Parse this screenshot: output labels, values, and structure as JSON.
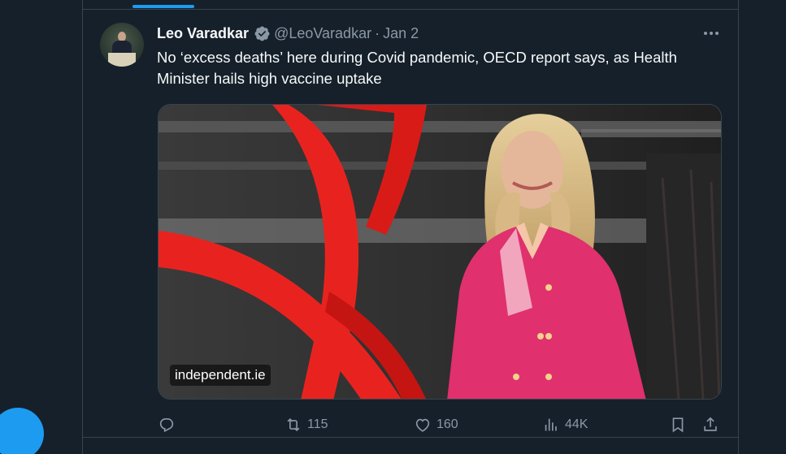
{
  "tweet": {
    "display_name": "Leo Varadkar",
    "handle": "@LeoVaradkar",
    "separator": "·",
    "date": "Jan 2",
    "text": "No ‘excess deaths’ here during Covid pandemic, OECD report says, as Health Minister hails high vaccine uptake",
    "verified": true,
    "more_icon": "more-horizontal-icon"
  },
  "card": {
    "source": "independent.ie"
  },
  "actions": {
    "reply": {
      "icon": "reply-icon",
      "count": ""
    },
    "retweet": {
      "icon": "retweet-icon",
      "count": "115"
    },
    "like": {
      "icon": "heart-icon",
      "count": "160"
    },
    "views": {
      "icon": "views-icon",
      "count": "44K"
    },
    "bookmark": {
      "icon": "bookmark-icon"
    },
    "share": {
      "icon": "share-icon"
    }
  },
  "colors": {
    "background": "#15202b",
    "border": "#38444d",
    "accent": "#1d9bf0",
    "text_primary": "#f7f9f9",
    "text_secondary": "#8b98a5"
  }
}
